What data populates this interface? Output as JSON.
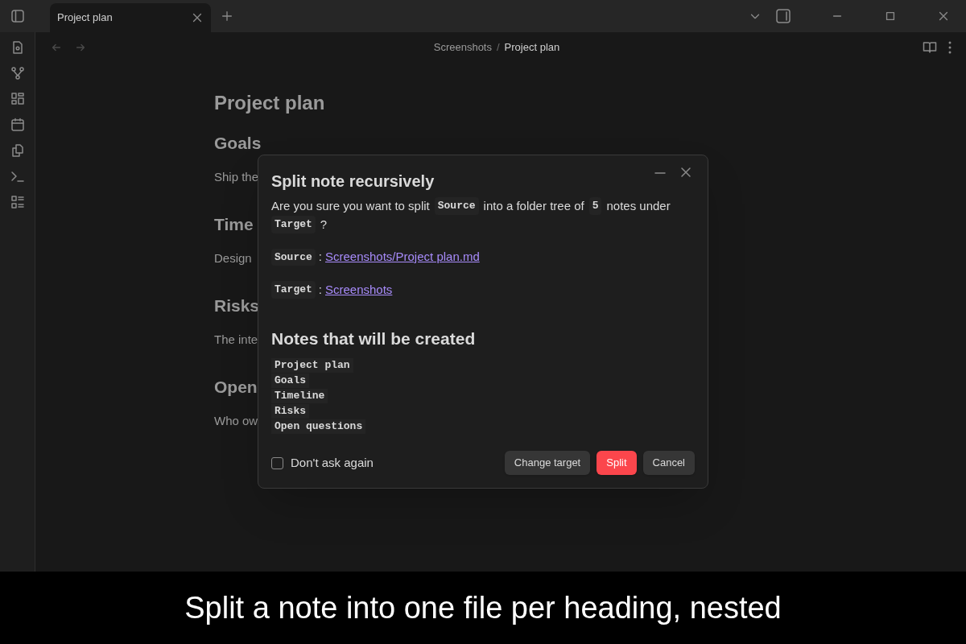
{
  "tabs": [
    {
      "label": "Project plan",
      "selected": true
    }
  ],
  "breadcrumb": {
    "folder": "Screenshots",
    "separator": "/",
    "note": "Project plan"
  },
  "note": {
    "title": "Project plan",
    "sections": [
      {
        "heading": "Goals",
        "text": "Ship the"
      },
      {
        "heading": "Time",
        "text": "Design"
      },
      {
        "heading": "Risks",
        "text": "The inte"
      },
      {
        "heading": "Open",
        "text": "Who ow"
      }
    ]
  },
  "dialog": {
    "title": "Split note recursively",
    "question": [
      {
        "kind": "text",
        "text": "Are you sure you want to split"
      },
      {
        "kind": "code",
        "text": "Source"
      },
      {
        "kind": "text",
        "text": "into a folder tree of"
      },
      {
        "kind": "code",
        "text": "5"
      },
      {
        "kind": "text",
        "text": "notes under"
      },
      {
        "kind": "code",
        "text": "Target"
      },
      {
        "kind": "text",
        "text": "?"
      }
    ],
    "fields": [
      {
        "label": "Source",
        "separator": ":",
        "link": "Screenshots/Project plan.md"
      },
      {
        "label": "Target",
        "separator": ":",
        "link": "Screenshots"
      }
    ],
    "list_heading": "Notes that will be created",
    "notes": [
      "Project plan",
      "Goals",
      "Timeline",
      "Risks",
      "Open questions"
    ],
    "checkbox": {
      "label": "Don't ask again",
      "checked": false
    },
    "buttons": [
      {
        "label": "Change target",
        "kind": "secondary"
      },
      {
        "label": "Split",
        "kind": "primary"
      },
      {
        "label": "Cancel",
        "kind": "secondary"
      }
    ]
  },
  "caption": "Split a note into one file per heading, nested"
}
